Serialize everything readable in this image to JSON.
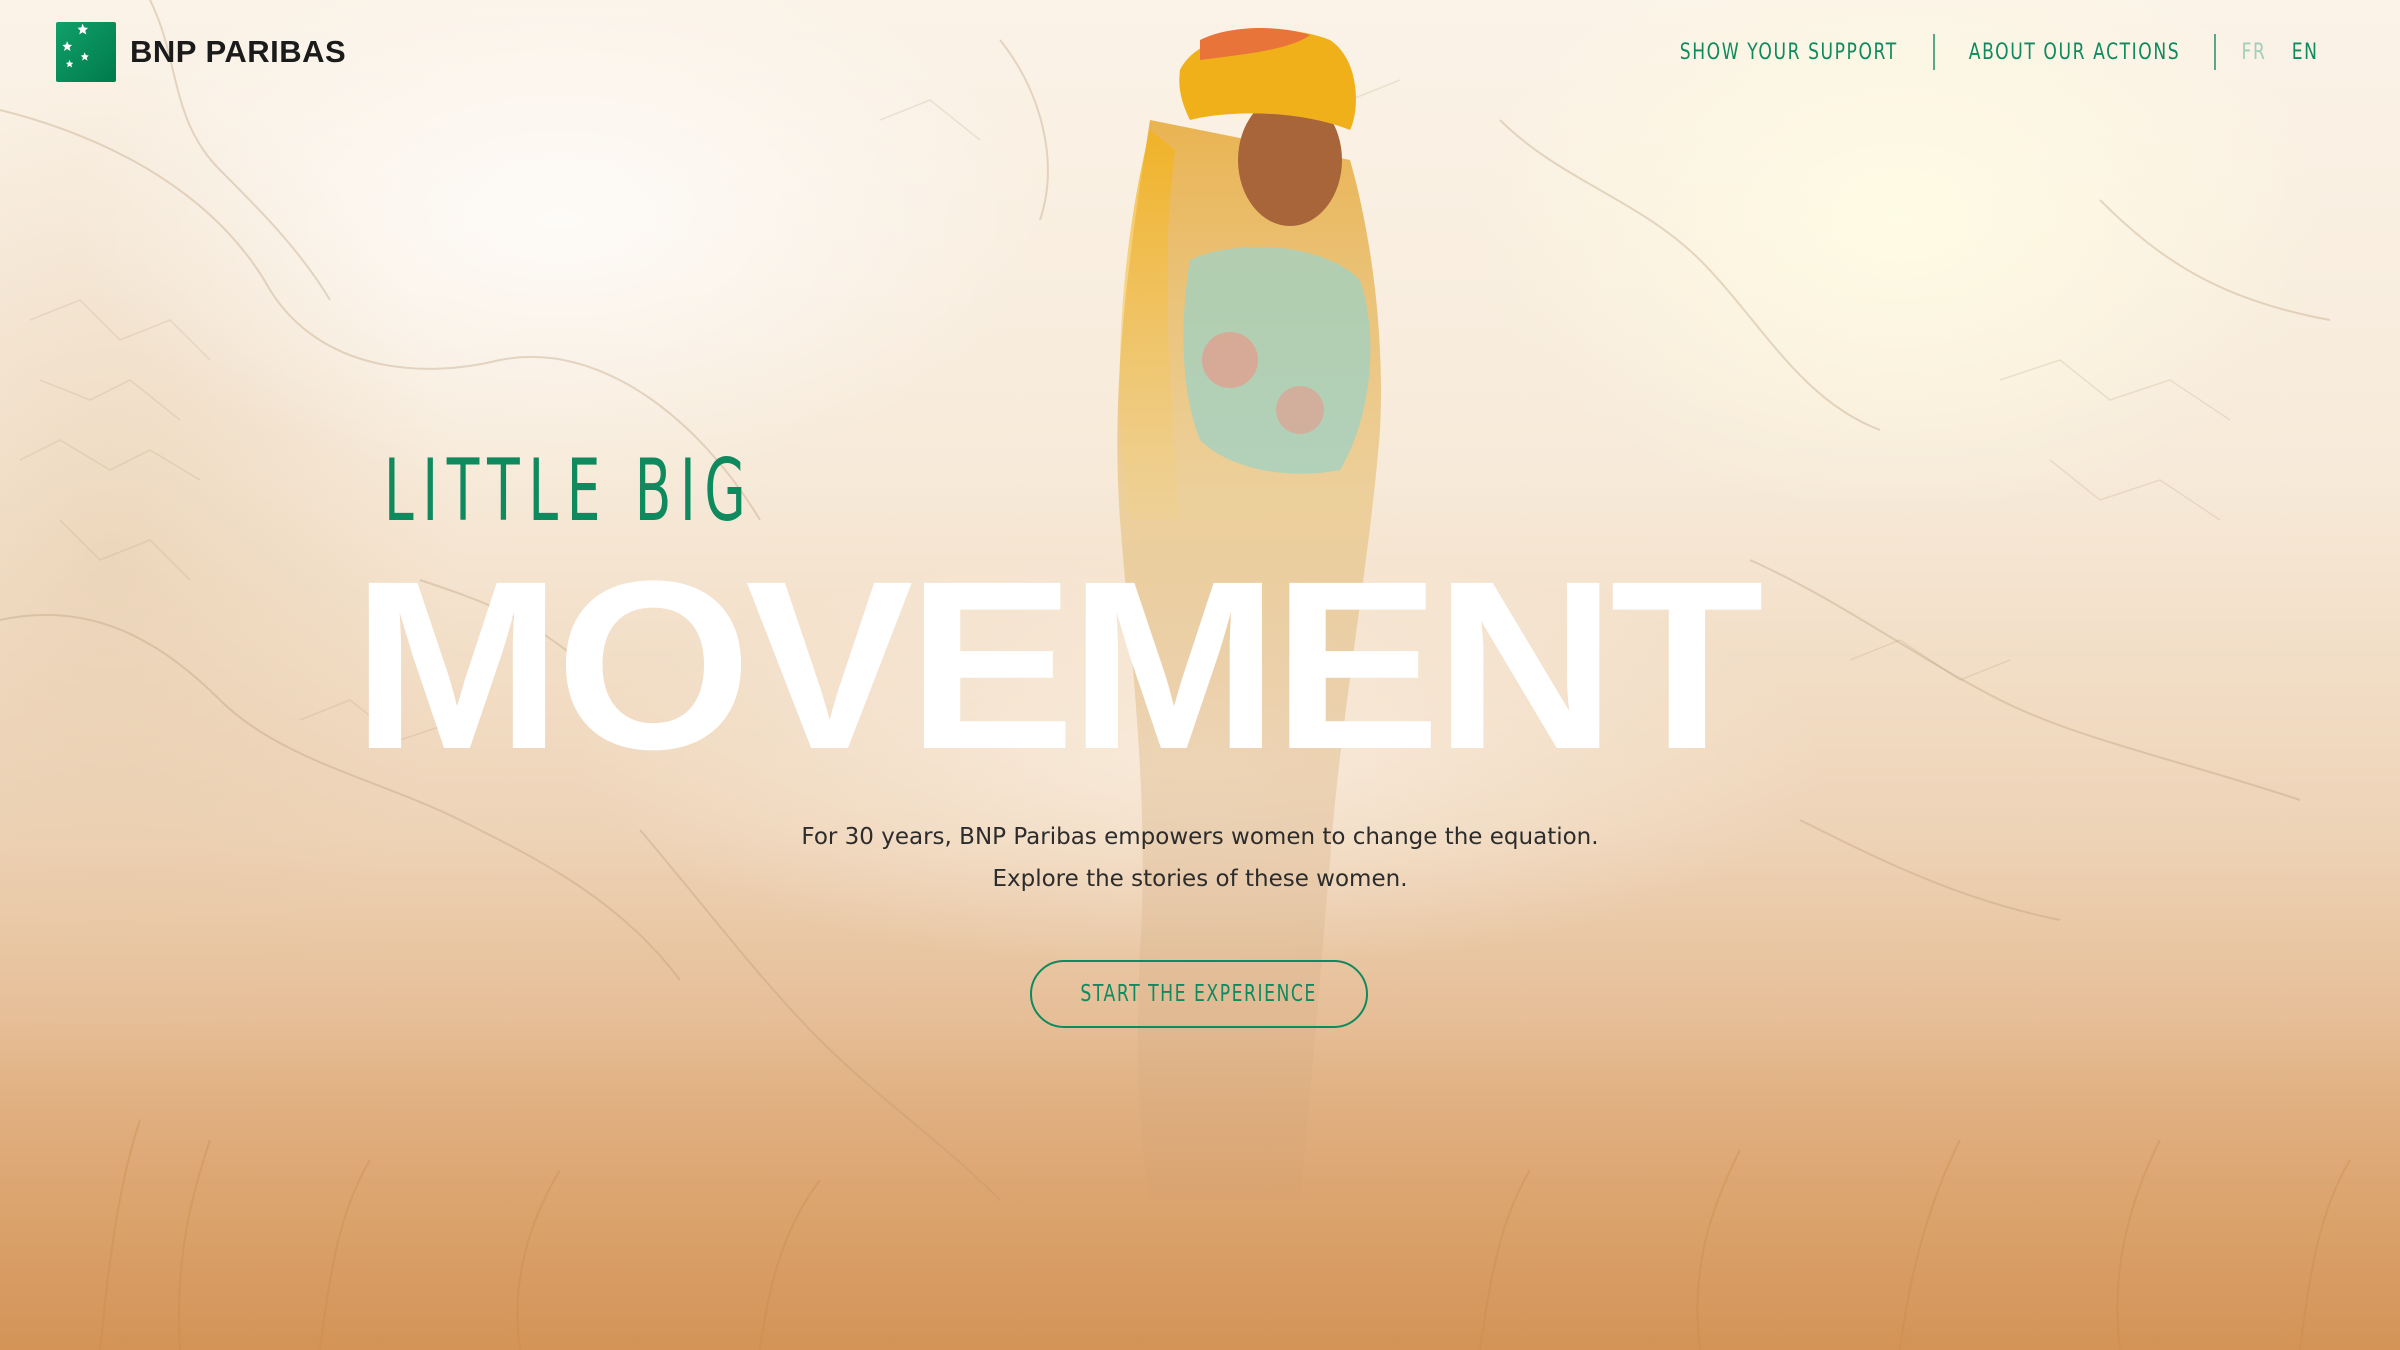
{
  "header": {
    "brand": "BNP PARIBAS",
    "logo_icon": "bnp-stars-logo-icon",
    "nav": [
      {
        "label": "SHOW YOUR SUPPORT"
      },
      {
        "label": "ABOUT OUR ACTIONS"
      }
    ],
    "languages": [
      {
        "code": "FR",
        "active": false
      },
      {
        "code": "EN",
        "active": true
      }
    ]
  },
  "hero": {
    "title_small": "LITTLE BIG",
    "title_big": "MOVEMENT",
    "tagline_line1": "For 30 years, BNP Paribas empowers women to change the equation.",
    "tagline_line2": "Explore the stories of these women.",
    "cta_label": "START THE EXPERIENCE"
  },
  "colors": {
    "brand_green": "#0f8a5f",
    "logo_green": "#00915a",
    "title_white": "#ffffff",
    "text_dark": "#2c2c2c"
  }
}
